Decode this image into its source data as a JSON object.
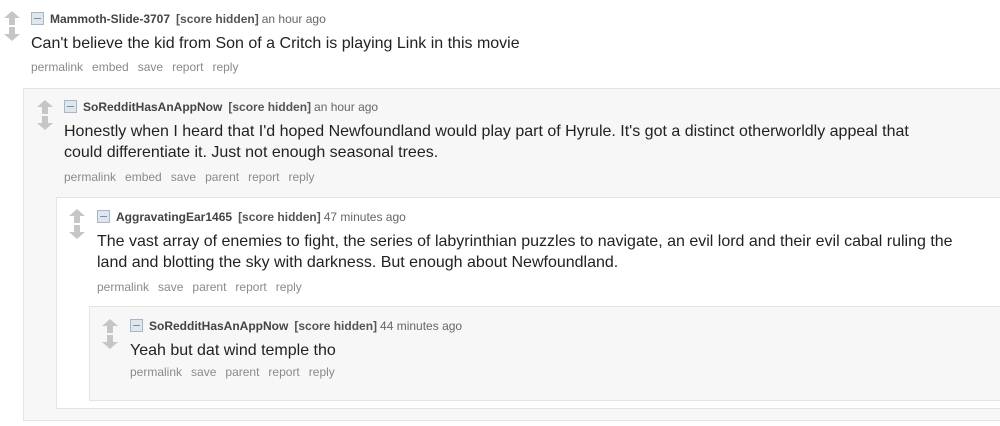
{
  "comments": [
    {
      "author": "Mammoth-Slide-3707",
      "score": "[score hidden]",
      "time": "an hour ago",
      "body": "Can't believe the kid from Son of a Critch is playing Link in this movie",
      "actions": [
        "permalink",
        "embed",
        "save",
        "report",
        "reply"
      ]
    },
    {
      "author": "SoRedditHasAnAppNow",
      "score": "[score hidden]",
      "time": "an hour ago",
      "body": "Honestly when I heard that I'd hoped Newfoundland would play part of Hyrule. It's got a distinct otherworldly appeal that could differentiate it. Just not enough seasonal trees.",
      "actions": [
        "permalink",
        "embed",
        "save",
        "parent",
        "report",
        "reply"
      ]
    },
    {
      "author": "AggravatingEar1465",
      "score": "[score hidden]",
      "time": "47 minutes ago",
      "body": "The vast array of enemies to fight, the series of labyrinthian puzzles to navigate, an evil lord and their evil cabal ruling the land and blotting the sky with darkness. But enough about Newfoundland.",
      "actions": [
        "permalink",
        "save",
        "parent",
        "report",
        "reply"
      ]
    },
    {
      "author": "SoRedditHasAnAppNow",
      "score": "[score hidden]",
      "time": "44 minutes ago",
      "body": "Yeah but dat wind temple tho",
      "actions": [
        "permalink",
        "save",
        "parent",
        "report",
        "reply"
      ]
    }
  ],
  "colors": {
    "nested_bg": "#f7f7f8",
    "border": "#e4e4e4",
    "arrow": "#c6c6c6"
  },
  "icons": [
    "upvote-arrow-icon",
    "downvote-arrow-icon",
    "collapse-toggle-icon"
  ]
}
